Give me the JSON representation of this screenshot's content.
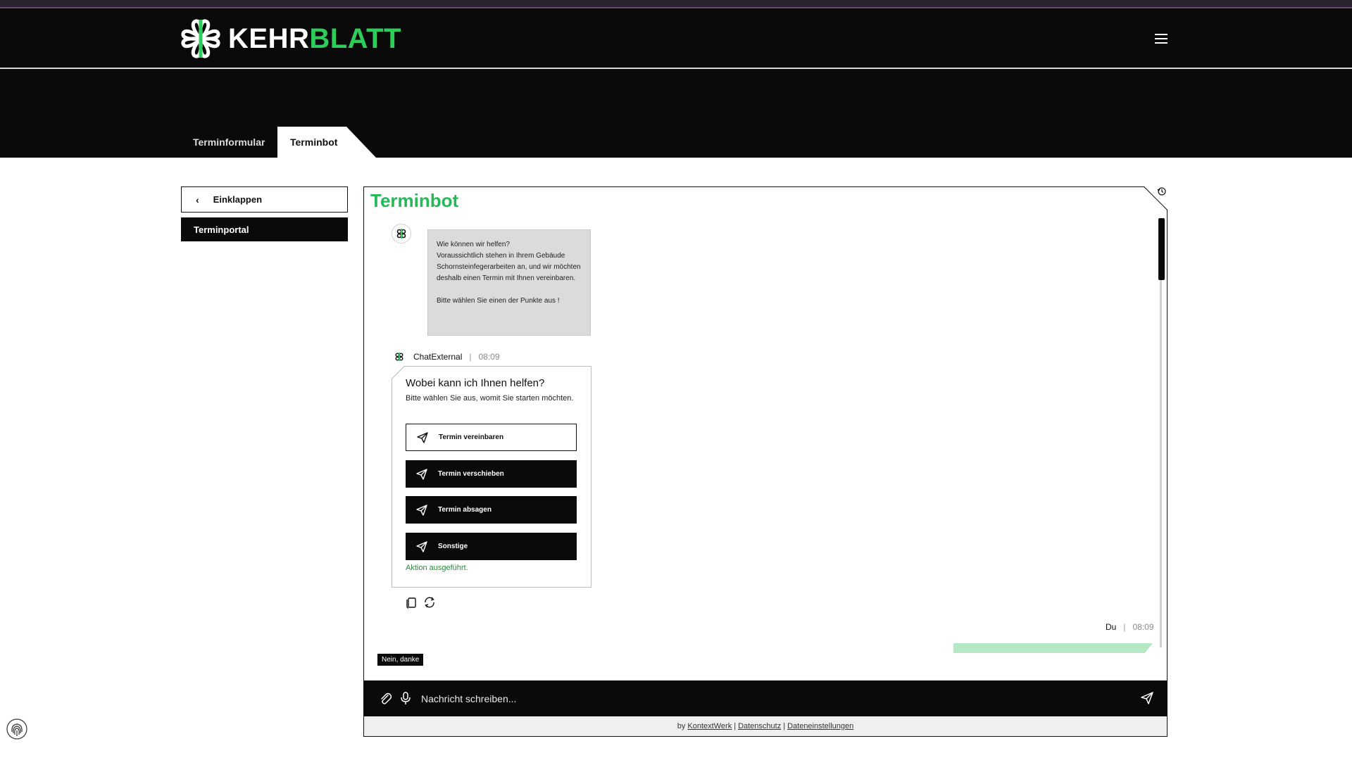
{
  "header": {
    "logo_part1": "KEHR",
    "logo_part2": "BLATT",
    "menu_icon": "hamburger-icon",
    "brand_green": "#2ecc5a"
  },
  "tabs": [
    {
      "label": "Terminformular",
      "active": false
    },
    {
      "label": "Terminbot",
      "active": true
    }
  ],
  "sidebar": {
    "collapse_label": "Einklappen",
    "collapse_icon": "chevron-left-icon",
    "portal_label": "Terminportal"
  },
  "chat": {
    "title": "Terminbot",
    "history_icon": "history-icon",
    "intro_lines": [
      "Wie können wir helfen?",
      "Voraussichtlich stehen in Ihrem Gebäude Schornsteinfegerarbeiten an, und wir möchten deshalb einen Termin mit Ihnen vereinbaren."
    ],
    "intro_footer": "Bitte wählen Sie einen der Punkte aus !",
    "sender": "ChatExternal",
    "sender_time": "08:09",
    "card": {
      "title": "Wobei kann ich Ihnen helfen?",
      "subtitle": "Bitte wählen Sie aus, womit Sie starten möchten.",
      "options": [
        {
          "label": "Termin vereinbaren",
          "style": "outline"
        },
        {
          "label": "Termin verschieben",
          "style": "dark"
        },
        {
          "label": "Termin absagen",
          "style": "dark"
        },
        {
          "label": "Sonstige",
          "style": "dark"
        }
      ],
      "status": "Aktion ausgeführt.",
      "status_color": "#2a8a3e"
    },
    "message_actions": [
      "copy-icon",
      "refresh-icon"
    ],
    "user_sender": "Du",
    "user_time": "08:09",
    "user_bubble_color": "#b5e8c5",
    "quick_reply": "Nein, danke"
  },
  "input": {
    "placeholder": "Nachricht schreiben...",
    "value": "",
    "icons": [
      "paperclip-icon",
      "microphone-icon",
      "send-icon"
    ]
  },
  "footer": {
    "prefix": "by",
    "links": [
      "KontextWerk",
      "Datenschutz",
      "Dateneinstellungen"
    ]
  }
}
